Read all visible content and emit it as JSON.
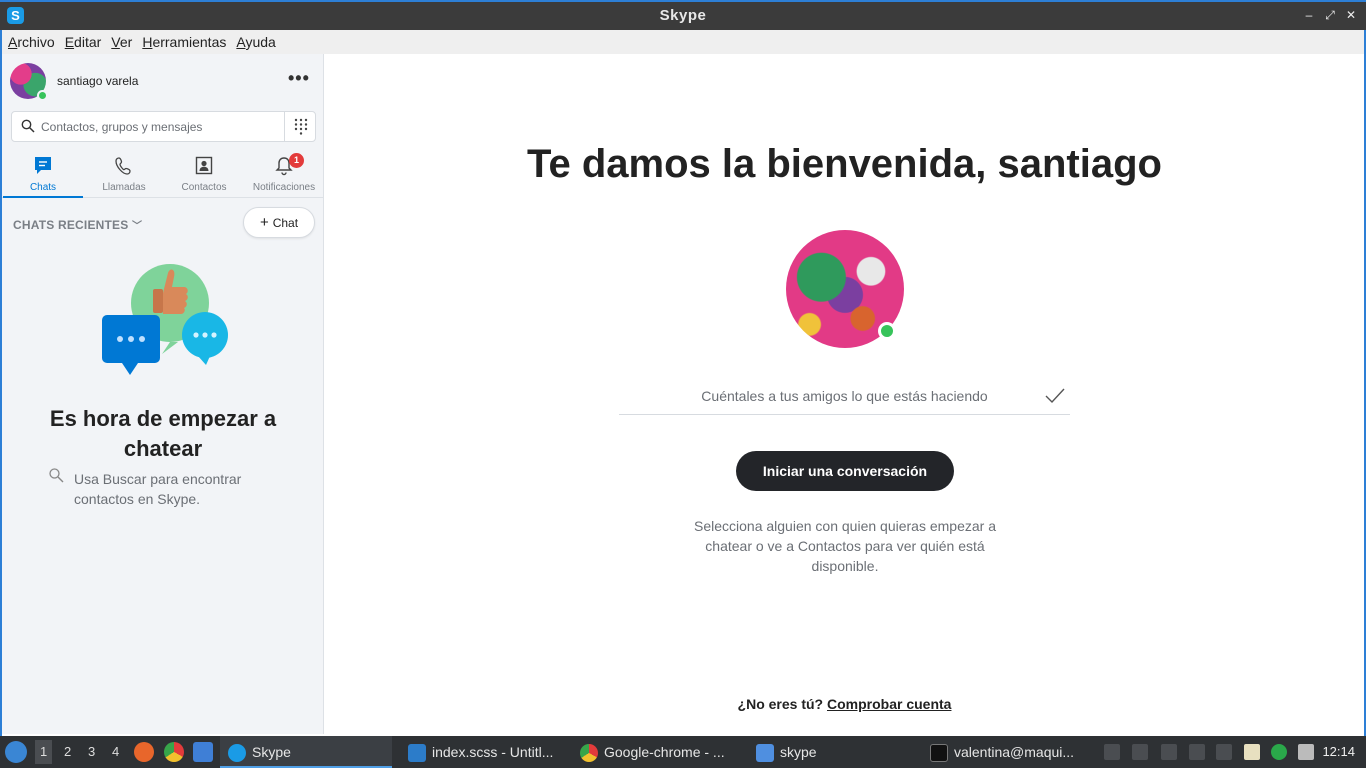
{
  "window": {
    "title": "Skype"
  },
  "menu": [
    "Archivo",
    "Editar",
    "Ver",
    "Herramientas",
    "Ayuda"
  ],
  "sidebar": {
    "user_name": "santiago varela",
    "more_label": "•••",
    "search_placeholder": "Contactos, grupos y mensajes",
    "tabs": [
      {
        "label": "Chats",
        "active": true,
        "icon": "chat-icon"
      },
      {
        "label": "Llamadas",
        "icon": "phone-icon"
      },
      {
        "label": "Contactos",
        "icon": "contacts-icon"
      },
      {
        "label": "Notificaciones",
        "icon": "bell-icon",
        "badge": "1"
      }
    ],
    "recent_label": "CHATS RECIENTES",
    "new_chat_label": "Chat",
    "empty_title": "Es hora de empezar a chatear",
    "empty_hint": "Usa Buscar para encontrar contactos en Skype."
  },
  "main": {
    "welcome": "Te damos la bienvenida, santiago",
    "mood_placeholder": "Cuéntales a tus amigos lo que estás haciendo",
    "start_button": "Iniciar una conversación",
    "help_text": "Selecciona alguien con quien quieras empezar a chatear o ve a Contactos para ver quién está disponible.",
    "not_you": "¿No eres tú?",
    "check_account": "Comprobar cuenta"
  },
  "taskbar": {
    "workspaces": [
      "1",
      "2",
      "3",
      "4"
    ],
    "tasks": [
      {
        "label": "Skype",
        "active": true
      },
      {
        "label": "index.scss - Untitl..."
      },
      {
        "label": "Google-chrome - ..."
      },
      {
        "label": "skype"
      },
      {
        "label": "valentina@maqui..."
      }
    ],
    "clock": "12:14"
  },
  "colors": {
    "accent": "#0078d4",
    "online": "#37c35a",
    "badge": "#e33b3b",
    "primary_button": "#232529"
  }
}
